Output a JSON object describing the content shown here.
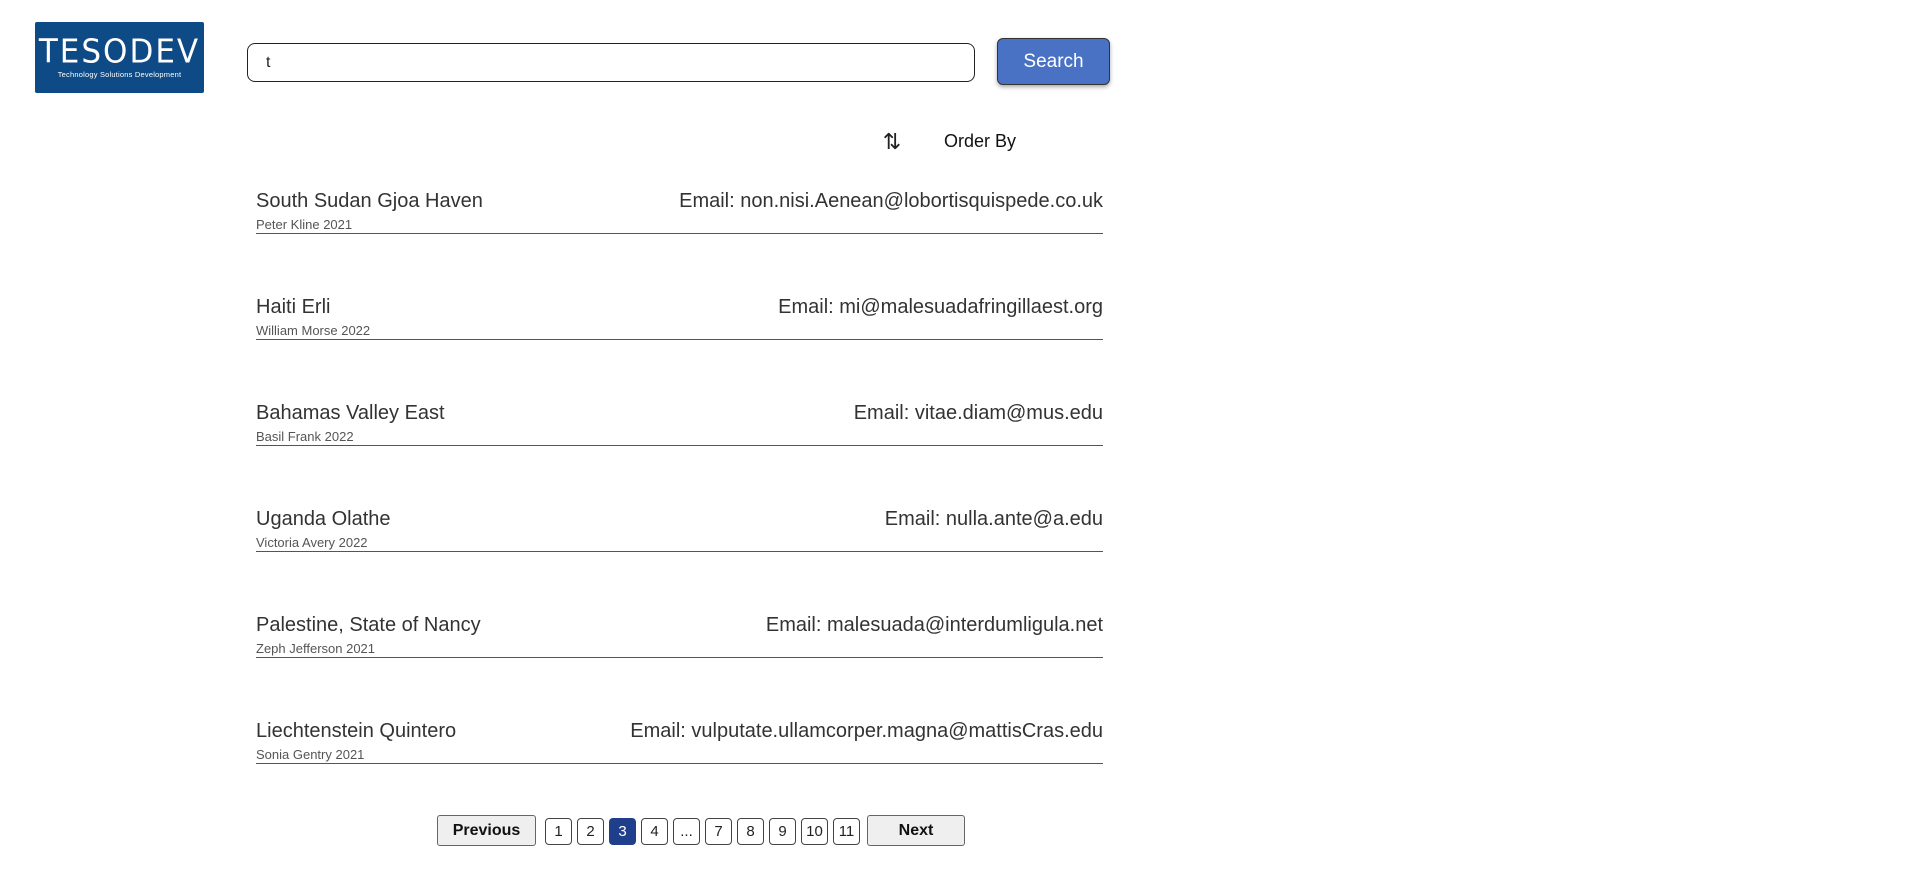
{
  "logo": {
    "word": "TESODEV",
    "tagline": "Technology Solutions Development"
  },
  "search": {
    "value": "t",
    "placeholder": "",
    "button_label": "Search"
  },
  "order": {
    "icon": "sort-arrows-icon",
    "icon_glyph": "⇅",
    "label": "Order By"
  },
  "results": [
    {
      "title": "South Sudan Gjoa Haven",
      "subtitle": "Peter Kline 2021",
      "email": "Email: non.nisi.Aenean@lobortisquispede.co.uk"
    },
    {
      "title": "Haiti Erli",
      "subtitle": "William Morse 2022",
      "email": "Email: mi@malesuadafringillaest.org"
    },
    {
      "title": "Bahamas Valley East",
      "subtitle": "Basil Frank 2022",
      "email": "Email: vitae.diam@mus.edu"
    },
    {
      "title": "Uganda Olathe",
      "subtitle": "Victoria Avery 2022",
      "email": "Email: nulla.ante@a.edu"
    },
    {
      "title": "Palestine, State of Nancy",
      "subtitle": "Zeph Jefferson 2021",
      "email": "Email: malesuada@interdumligula.net"
    },
    {
      "title": "Liechtenstein Quintero",
      "subtitle": "Sonia Gentry 2021",
      "email": "Email: vulputate.ullamcorper.magna@mattisCras.edu"
    }
  ],
  "pagination": {
    "previous_label": "Previous",
    "next_label": "Next",
    "pages": [
      "1",
      "2",
      "3",
      "4",
      "...",
      "7",
      "8",
      "9",
      "10",
      "11"
    ],
    "current": "3"
  },
  "colors": {
    "brand": "#0d4a86",
    "button": "#4a72c4",
    "active_page": "#1f3f8c"
  }
}
